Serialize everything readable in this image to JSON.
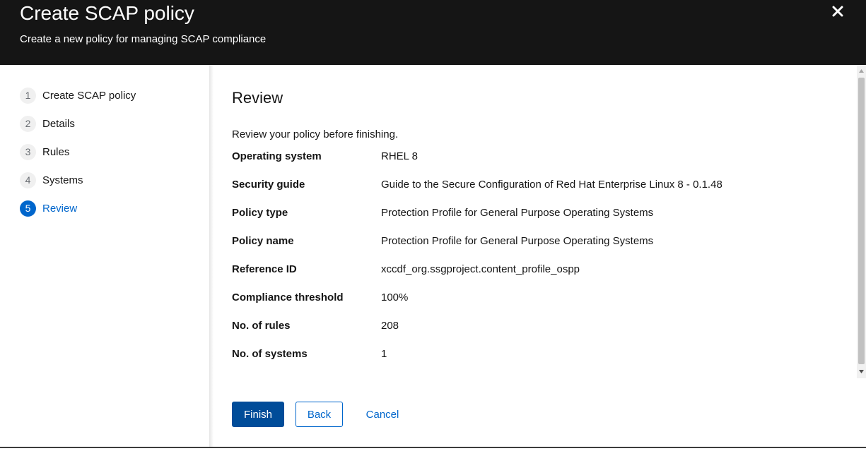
{
  "header": {
    "title": "Create SCAP policy",
    "description": "Create a new policy for managing SCAP compliance",
    "close_icon": "close-icon"
  },
  "nav": {
    "steps": [
      {
        "num": "1",
        "label": "Create SCAP policy"
      },
      {
        "num": "2",
        "label": "Details"
      },
      {
        "num": "3",
        "label": "Rules"
      },
      {
        "num": "4",
        "label": "Systems"
      },
      {
        "num": "5",
        "label": "Review"
      }
    ],
    "active_step": "5"
  },
  "main": {
    "title": "Review",
    "description": "Review your policy before finishing.",
    "rows": [
      {
        "label": "Operating system",
        "value": "RHEL 8"
      },
      {
        "label": "Security guide",
        "value": "Guide to the Secure Configuration of Red Hat Enterprise Linux 8 - 0.1.48"
      },
      {
        "label": "Policy type",
        "value": "Protection Profile for General Purpose Operating Systems"
      },
      {
        "label": "Policy name",
        "value": "Protection Profile for General Purpose Operating Systems"
      },
      {
        "label": "Reference ID",
        "value": "xccdf_org.ssgproject.content_profile_ospp"
      },
      {
        "label": "Compliance threshold",
        "value": "100%"
      },
      {
        "label": "No. of rules",
        "value": "208"
      },
      {
        "label": "No. of systems",
        "value": "1"
      }
    ]
  },
  "footer": {
    "finish_label": "Finish",
    "back_label": "Back",
    "cancel_label": "Cancel"
  },
  "colors": {
    "header_bg": "#151515",
    "accent": "#0066cc",
    "primary_button": "#004c99"
  }
}
